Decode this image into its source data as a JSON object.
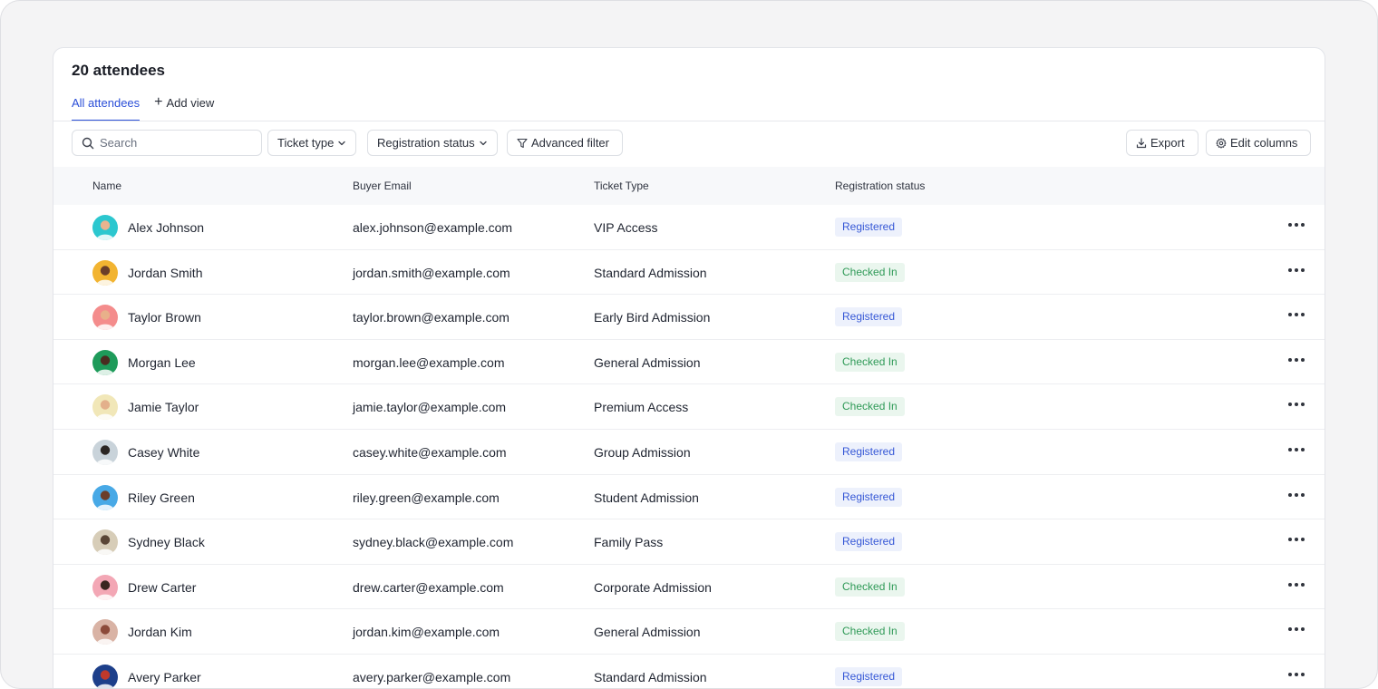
{
  "header": {
    "title": "20 attendees"
  },
  "tabs": {
    "all_label": "All attendees",
    "add_label": "Add view"
  },
  "toolbar": {
    "search_placeholder": "Search",
    "ticket_type_label": "Ticket type",
    "registration_status_label": "Registration status",
    "advanced_filter_label": "Advanced filter",
    "export_label": "Export",
    "edit_columns_label": "Edit columns"
  },
  "table": {
    "columns": [
      "Name",
      "Buyer Email",
      "Ticket Type",
      "Registration status"
    ],
    "rows": [
      {
        "name": "Alex Johnson",
        "email": "alex.johnson@example.com",
        "ticket": "VIP Access",
        "status": "Registered",
        "avatar_bg": "#2cc7cf",
        "avatar_fg": "#e9b48f"
      },
      {
        "name": "Jordan Smith",
        "email": "jordan.smith@example.com",
        "ticket": "Standard Admission",
        "status": "Checked In",
        "avatar_bg": "#f2b431",
        "avatar_fg": "#6a3e29"
      },
      {
        "name": "Taylor Brown",
        "email": "taylor.brown@example.com",
        "ticket": "Early Bird Admission",
        "status": "Registered",
        "avatar_bg": "#f48c8c",
        "avatar_fg": "#e8b08a"
      },
      {
        "name": "Morgan Lee",
        "email": "morgan.lee@example.com",
        "ticket": "General Admission",
        "status": "Checked In",
        "avatar_bg": "#1e9b5a",
        "avatar_fg": "#4a2c20"
      },
      {
        "name": "Jamie Taylor",
        "email": "jamie.taylor@example.com",
        "ticket": "Premium Access",
        "status": "Checked In",
        "avatar_bg": "#f1e7b8",
        "avatar_fg": "#e3b08b"
      },
      {
        "name": "Casey White",
        "email": "casey.white@example.com",
        "ticket": "Group Admission",
        "status": "Registered",
        "avatar_bg": "#c9d3da",
        "avatar_fg": "#2b2623"
      },
      {
        "name": "Riley Green",
        "email": "riley.green@example.com",
        "ticket": "Student Admission",
        "status": "Registered",
        "avatar_bg": "#48a9e6",
        "avatar_fg": "#6b3e2a"
      },
      {
        "name": "Sydney Black",
        "email": "sydney.black@example.com",
        "ticket": "Family Pass",
        "status": "Registered",
        "avatar_bg": "#d7cdb8",
        "avatar_fg": "#5a4636"
      },
      {
        "name": "Drew Carter",
        "email": "drew.carter@example.com",
        "ticket": "Corporate Admission",
        "status": "Checked In",
        "avatar_bg": "#f3a7b5",
        "avatar_fg": "#3a2620"
      },
      {
        "name": "Jordan Kim",
        "email": "jordan.kim@example.com",
        "ticket": "General Admission",
        "status": "Checked In",
        "avatar_bg": "#d9b3a5",
        "avatar_fg": "#8c4a3a"
      },
      {
        "name": "Avery Parker",
        "email": "avery.parker@example.com",
        "ticket": "Standard Admission",
        "status": "Registered",
        "avatar_bg": "#1d3f8a",
        "avatar_fg": "#c0392b"
      }
    ]
  },
  "colors": {
    "accent": "#2b4fd8",
    "registered_bg": "#edf1fc",
    "registered_text": "#3557d6",
    "checked_bg": "#eaf6ee",
    "checked_text": "#2f9a57"
  },
  "icons": {
    "search": "search-icon",
    "plus": "plus-icon",
    "chevron": "chevron-down-icon",
    "filter": "filter-icon",
    "export": "download-icon",
    "settings": "gear-icon",
    "more": "more-horizontal-icon"
  }
}
